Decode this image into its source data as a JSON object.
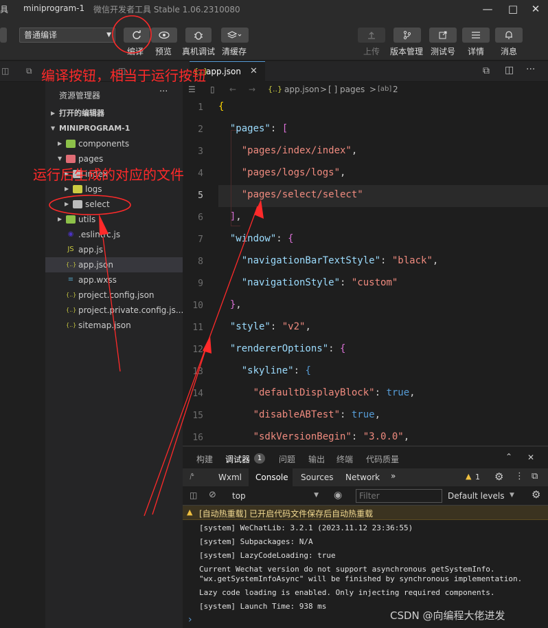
{
  "titlebar": {
    "left_frag": "具",
    "project": "miniprogram-1",
    "app_name": "微信开发者工具 Stable 1.06.2310080"
  },
  "toolbar": {
    "compile_mode": "普通编译",
    "compile_label": "编译",
    "preview_label": "预览",
    "remote_debug_label": "真机调试",
    "clear_cache_label": "清缓存",
    "upload_label": "上传",
    "version_label": "版本管理",
    "test_label": "测试号",
    "details_label": "详情",
    "messages_label": "消息"
  },
  "tabs": [
    {
      "label": "app.json",
      "active": true
    }
  ],
  "explorer": {
    "title": "资源管理器",
    "menu": "···",
    "open_editors": "打开的编辑器",
    "project": "MINIPROGRAM-1",
    "items": [
      {
        "label": "components",
        "type": "folder",
        "color": "#8dc149"
      },
      {
        "label": "pages",
        "type": "folder",
        "color": "#e06c75"
      },
      {
        "label": "index",
        "type": "folder",
        "color": "#bbbbbb"
      },
      {
        "label": "logs",
        "type": "folder",
        "color": "#cbcb41"
      },
      {
        "label": "select",
        "type": "folder",
        "color": "#bbbbbb"
      },
      {
        "label": "utils",
        "type": "folder",
        "color": "#8dc149"
      },
      {
        "label": ".eslintrc.js",
        "type": "file",
        "icon": "eslint-icon",
        "color": "#4b32c3"
      },
      {
        "label": "app.js",
        "type": "file",
        "icon": "js-icon",
        "color": "#cbcb41"
      },
      {
        "label": "app.json",
        "type": "file",
        "icon": "json-icon",
        "color": "#cbcb41",
        "selected": true
      },
      {
        "label": "app.wxss",
        "type": "file",
        "icon": "css-icon",
        "color": "#519aba"
      },
      {
        "label": "project.config.json",
        "type": "file",
        "icon": "json-icon",
        "color": "#cbcb41"
      },
      {
        "label": "project.private.config.js...",
        "type": "file",
        "icon": "json-icon",
        "color": "#cbcb41"
      },
      {
        "label": "sitemap.json",
        "type": "file",
        "icon": "json-icon",
        "color": "#cbcb41"
      }
    ]
  },
  "breadcrumb": {
    "file": "app.json",
    "sep1": ">",
    "arr": "[ ] pages",
    "sep2": ">",
    "idx": "2"
  },
  "code": {
    "line_numbers": [
      "1",
      "2",
      "3",
      "4",
      "5",
      "6",
      "7",
      "8",
      "9",
      "10",
      "11",
      "12",
      "13",
      "14",
      "15",
      "16"
    ]
  },
  "panel": {
    "tabs": [
      "构建",
      "调试器",
      "问题",
      "输出",
      "终端",
      "代码质量"
    ],
    "debugger_badge": "1",
    "devtools_tabs": [
      "Wxml",
      "Console",
      "Sources",
      "Network"
    ],
    "more": "»",
    "warn_count": "1",
    "context": "top",
    "filter_placeholder": "Filter",
    "levels": "Default levels",
    "logs": [
      "[自动热重载] 已开启代码文件保存后自动热重载",
      "[system] WeChatLib: 3.2.1 (2023.11.12 23:36:55)",
      "[system] Subpackages: N/A",
      "[system] LazyCodeLoading: true",
      "Current Wechat version do not support asynchronous getSystemInfo.",
      "\"wx.getSystemInfoAsync\" will be finished by synchronous implementation.",
      "Lazy code loading is enabled. Only injecting required components.",
      "[system] Launch Time: 938 ms"
    ],
    "prompt": "›"
  },
  "annotations": {
    "compile_note": "编译按钮，相当于运行按钮",
    "generated_note": "运行后生成的对应的文件",
    "color": "#ff2a2a"
  },
  "watermark": "CSDN @向编程大佬进发"
}
